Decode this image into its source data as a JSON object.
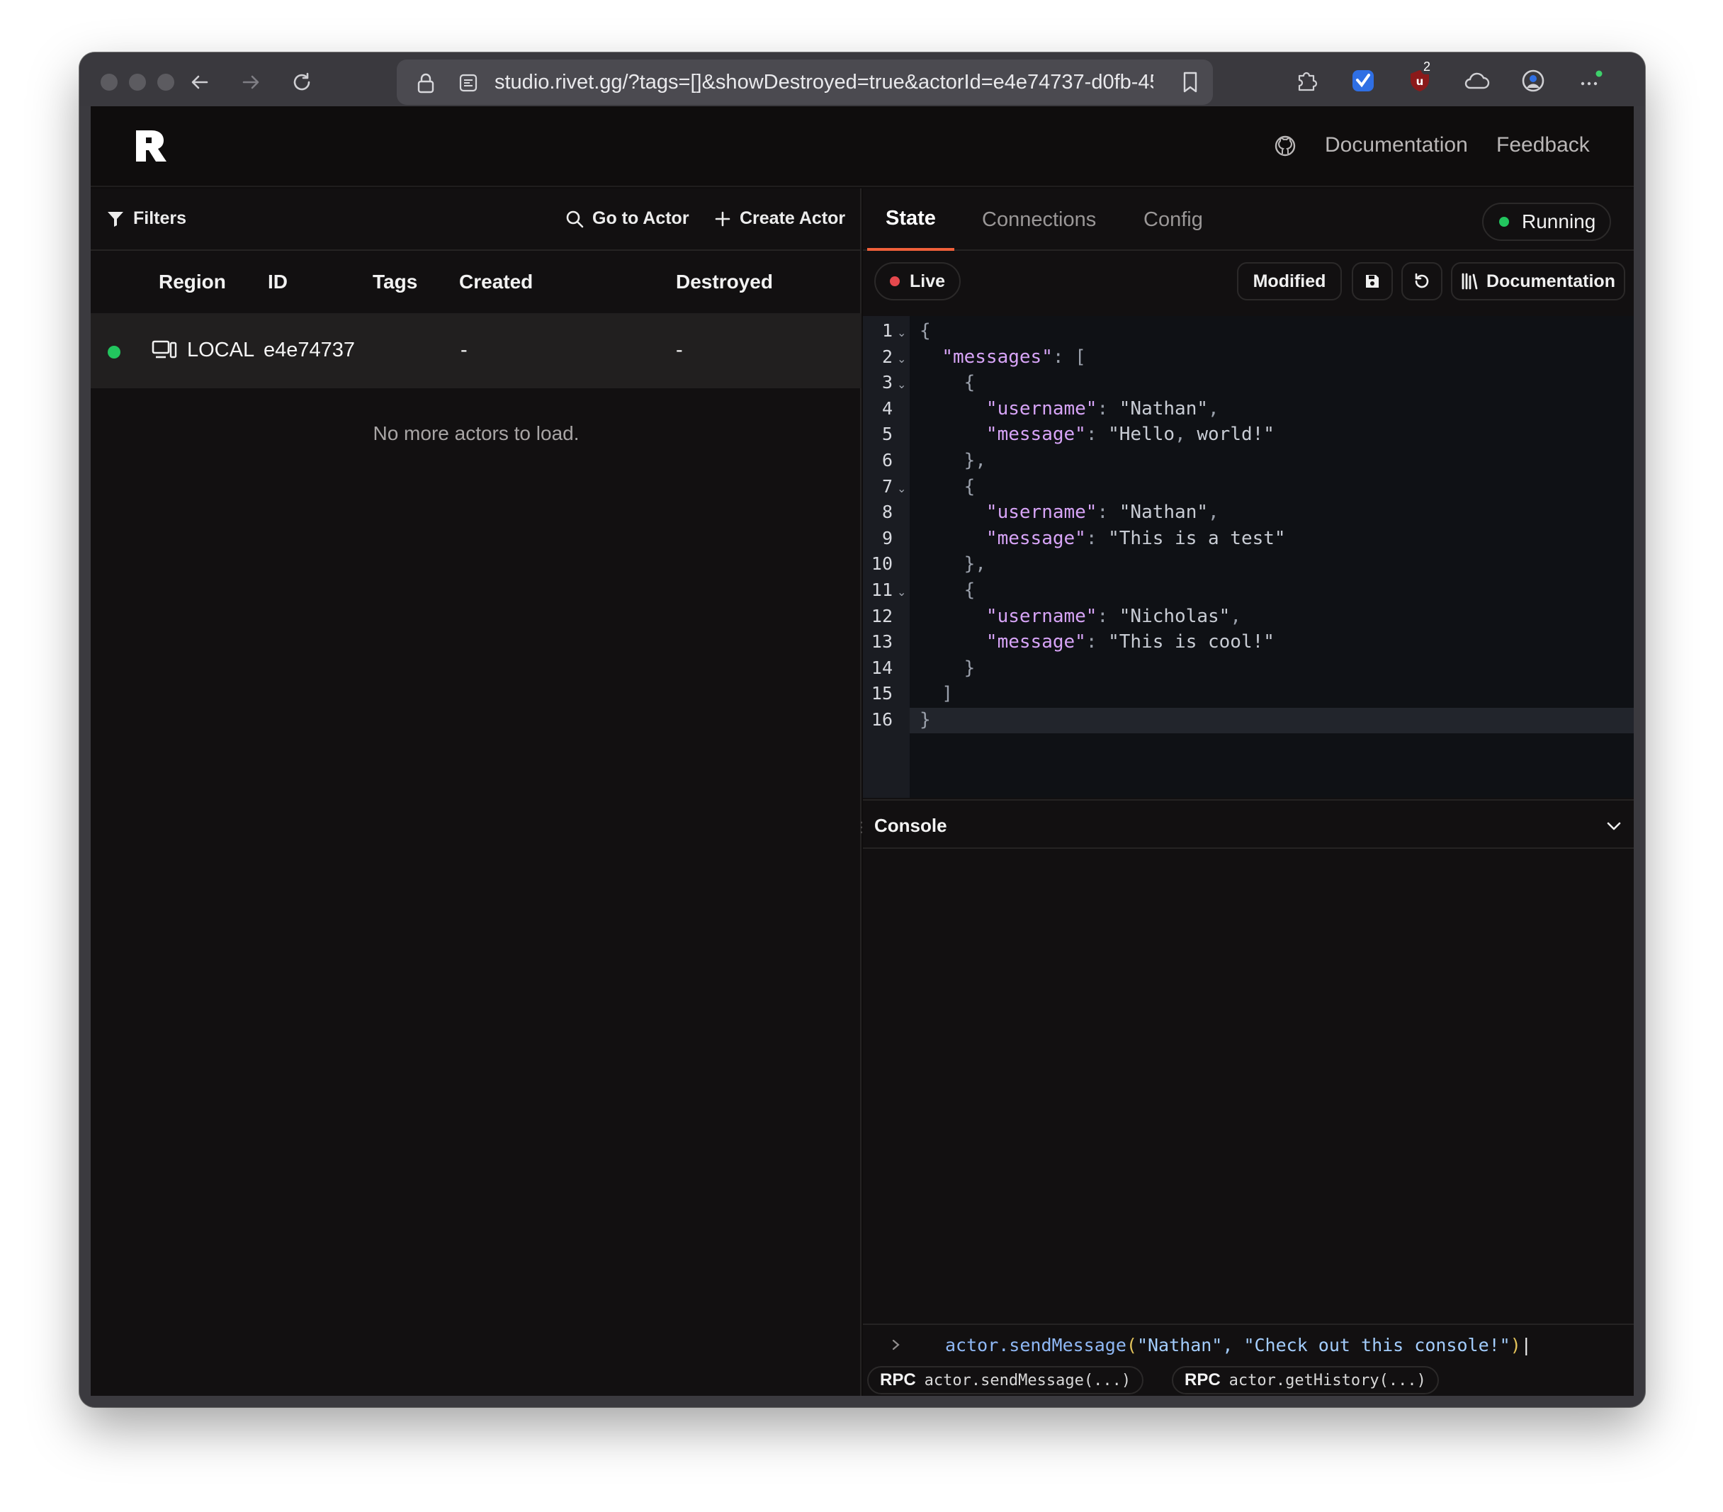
{
  "browser": {
    "url": "studio.rivet.gg/?tags=[]&showDestroyed=true&actorId=e4e74737-d0fb-45",
    "extension_badge": "2"
  },
  "app": {
    "topbar": {
      "documentation": "Documentation",
      "feedback": "Feedback"
    },
    "actors_panel": {
      "filters_label": "Filters",
      "go_to_actor_label": "Go to Actor",
      "create_actor_label": "Create Actor",
      "columns": [
        "Region",
        "ID",
        "Tags",
        "Created",
        "Destroyed"
      ],
      "rows": [
        {
          "status_color": "#22c55e",
          "region": "LOCAL",
          "id": "e4e74737",
          "created": "-",
          "destroyed": "-"
        }
      ],
      "empty_message": "No more actors to load."
    },
    "actor_panel": {
      "tabs": [
        "State",
        "Connections",
        "Config"
      ],
      "active_tab": "State",
      "status": "Running",
      "status_color": "#22c55e",
      "live_label": "Live",
      "live_color": "#e5484d",
      "modified_label": "Modified",
      "documentation_label": "Documentation",
      "editor_lines": [
        "{",
        "  \"messages\": [",
        "    {",
        "      \"username\": \"Nathan\",",
        "      \"message\": \"Hello, world!\"",
        "    },",
        "    {",
        "      \"username\": \"Nathan\",",
        "      \"message\": \"This is a test\"",
        "    },",
        "    {",
        "      \"username\": \"Nicholas\",",
        "      \"message\": \"This is cool!\"",
        "    }",
        "  ]",
        "}"
      ],
      "line_numbers": [
        "1",
        "2",
        "3",
        "4",
        "5",
        "6",
        "7",
        "8",
        "9",
        "10",
        "11",
        "12",
        "13",
        "14",
        "15",
        "16"
      ],
      "folded_lines": [
        1,
        2,
        3,
        7,
        11
      ],
      "console_title": "Console",
      "console_input": "actor.sendMessage(\"Nathan\", \"Check out this console!\")",
      "rpc_tag": "RPC",
      "rpc_calls": [
        "actor.sendMessage(...)",
        "actor.getHistory(...)"
      ]
    }
  }
}
